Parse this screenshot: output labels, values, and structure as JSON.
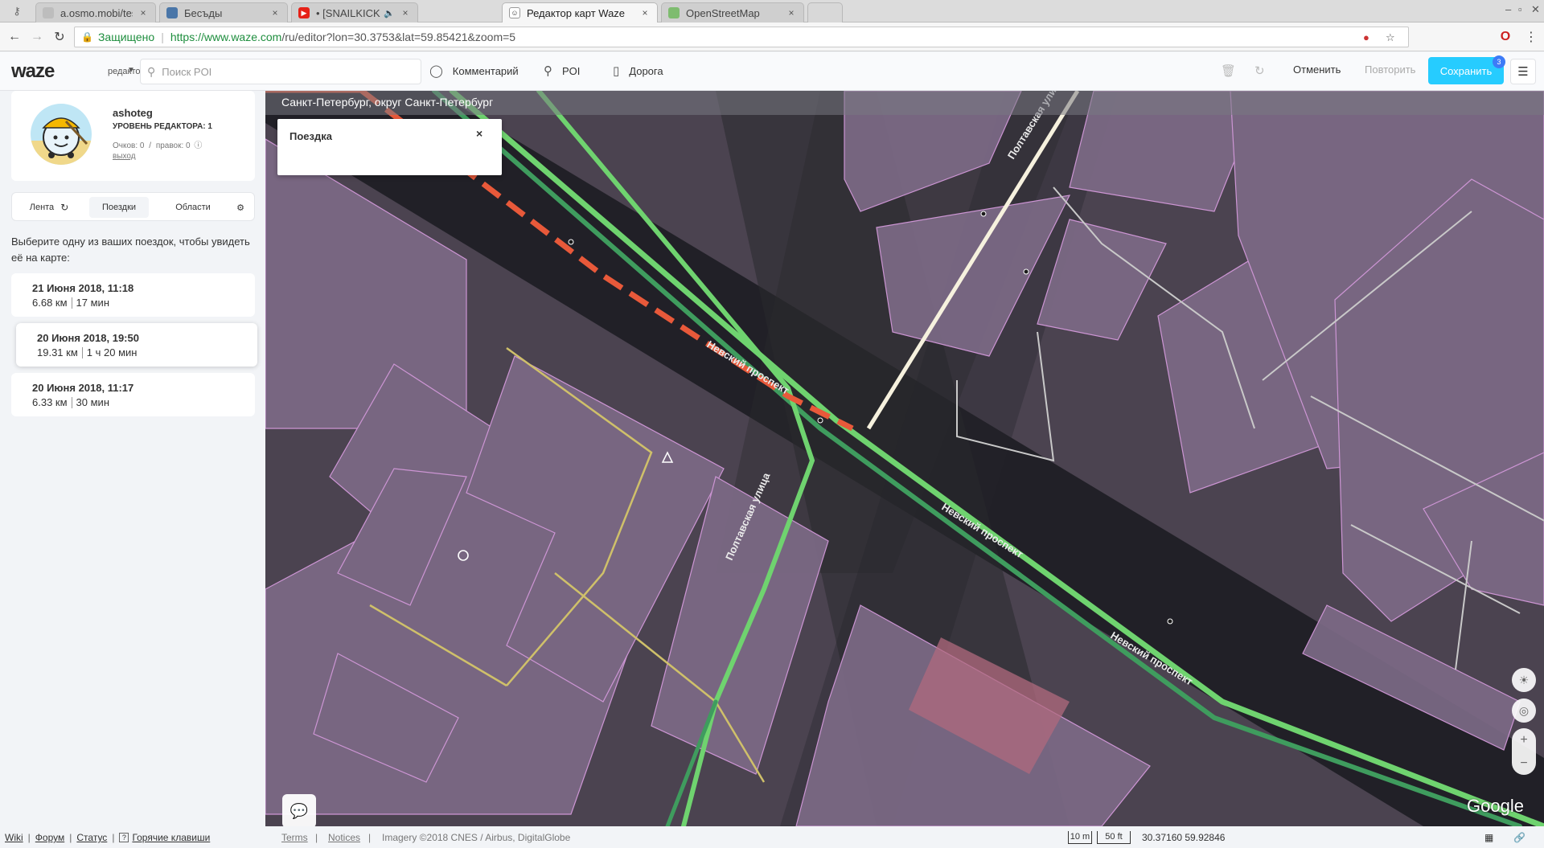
{
  "browser": {
    "tabs": [
      {
        "title": "a.osmo.mobi/test",
        "active": false
      },
      {
        "title": "Бесъды",
        "active": false
      },
      {
        "title": "• [SNAILKICK СМОТ",
        "active": false
      },
      {
        "title": "Редактор карт Waze",
        "active": true
      },
      {
        "title": "OpenStreetMap",
        "active": false
      }
    ],
    "tab_close": "×",
    "security_label": "Защищено",
    "url_host": "https://www.waze.com",
    "url_rest": "/ru/editor?lon=30.3753&lat=59.85421&zoom=5"
  },
  "toolbar": {
    "logo": "waze",
    "mode_label": "редактор",
    "search_placeholder": "Поиск POI",
    "comment_label": "Комментарий",
    "poi_label": "POI",
    "road_label": "Дорога",
    "undo_label": "Отменить",
    "redo_label": "Повторить",
    "save_label": "Сохранить",
    "save_count": "3"
  },
  "profile": {
    "username": "ashoteg",
    "level": "УРОВЕНЬ РЕДАКТОРА: 1",
    "points_label": "Очков: 0",
    "stats_sep": "/",
    "edits_label": "правок: 0",
    "logout": "выход"
  },
  "side_tabs": [
    {
      "label": "Лента"
    },
    {
      "label": "Поездки"
    },
    {
      "label": "Области"
    }
  ],
  "drives_hint": "Выберите одну из ваших поездок, чтобы увидеть её на карте:",
  "drives": [
    {
      "date": "21 Июня 2018, 11:18",
      "distance": "6.68 км",
      "duration": "17 мин"
    },
    {
      "date": "20 Июня 2018, 19:50",
      "distance": "19.31 км",
      "duration": "1 ч 20 мин"
    },
    {
      "date": "20 Июня 2018, 11:17",
      "distance": "6.33 км",
      "duration": "30 мин"
    }
  ],
  "map": {
    "breadcrumb": "Санкт-Петербург, округ Санкт-Петербург",
    "popup_title": "Поездка",
    "popup_close": "×",
    "street_labels": [
      "Невский проспект",
      "Невский проспект",
      "Невский проспект",
      "Полтавская улица",
      "Полтавская улица"
    ],
    "provider": "Google"
  },
  "footer": {
    "links": [
      "Wiki",
      "Форум",
      "Статус",
      "Горячие клавиши"
    ],
    "kbd": "?",
    "terms": "Terms",
    "notices": "Notices",
    "imagery": "Imagery ©2018 CNES / Airbus, DigitalGlobe",
    "scale_m": "10 m",
    "scale_ft": "50 ft",
    "coords": "30.37160 59.92846"
  }
}
